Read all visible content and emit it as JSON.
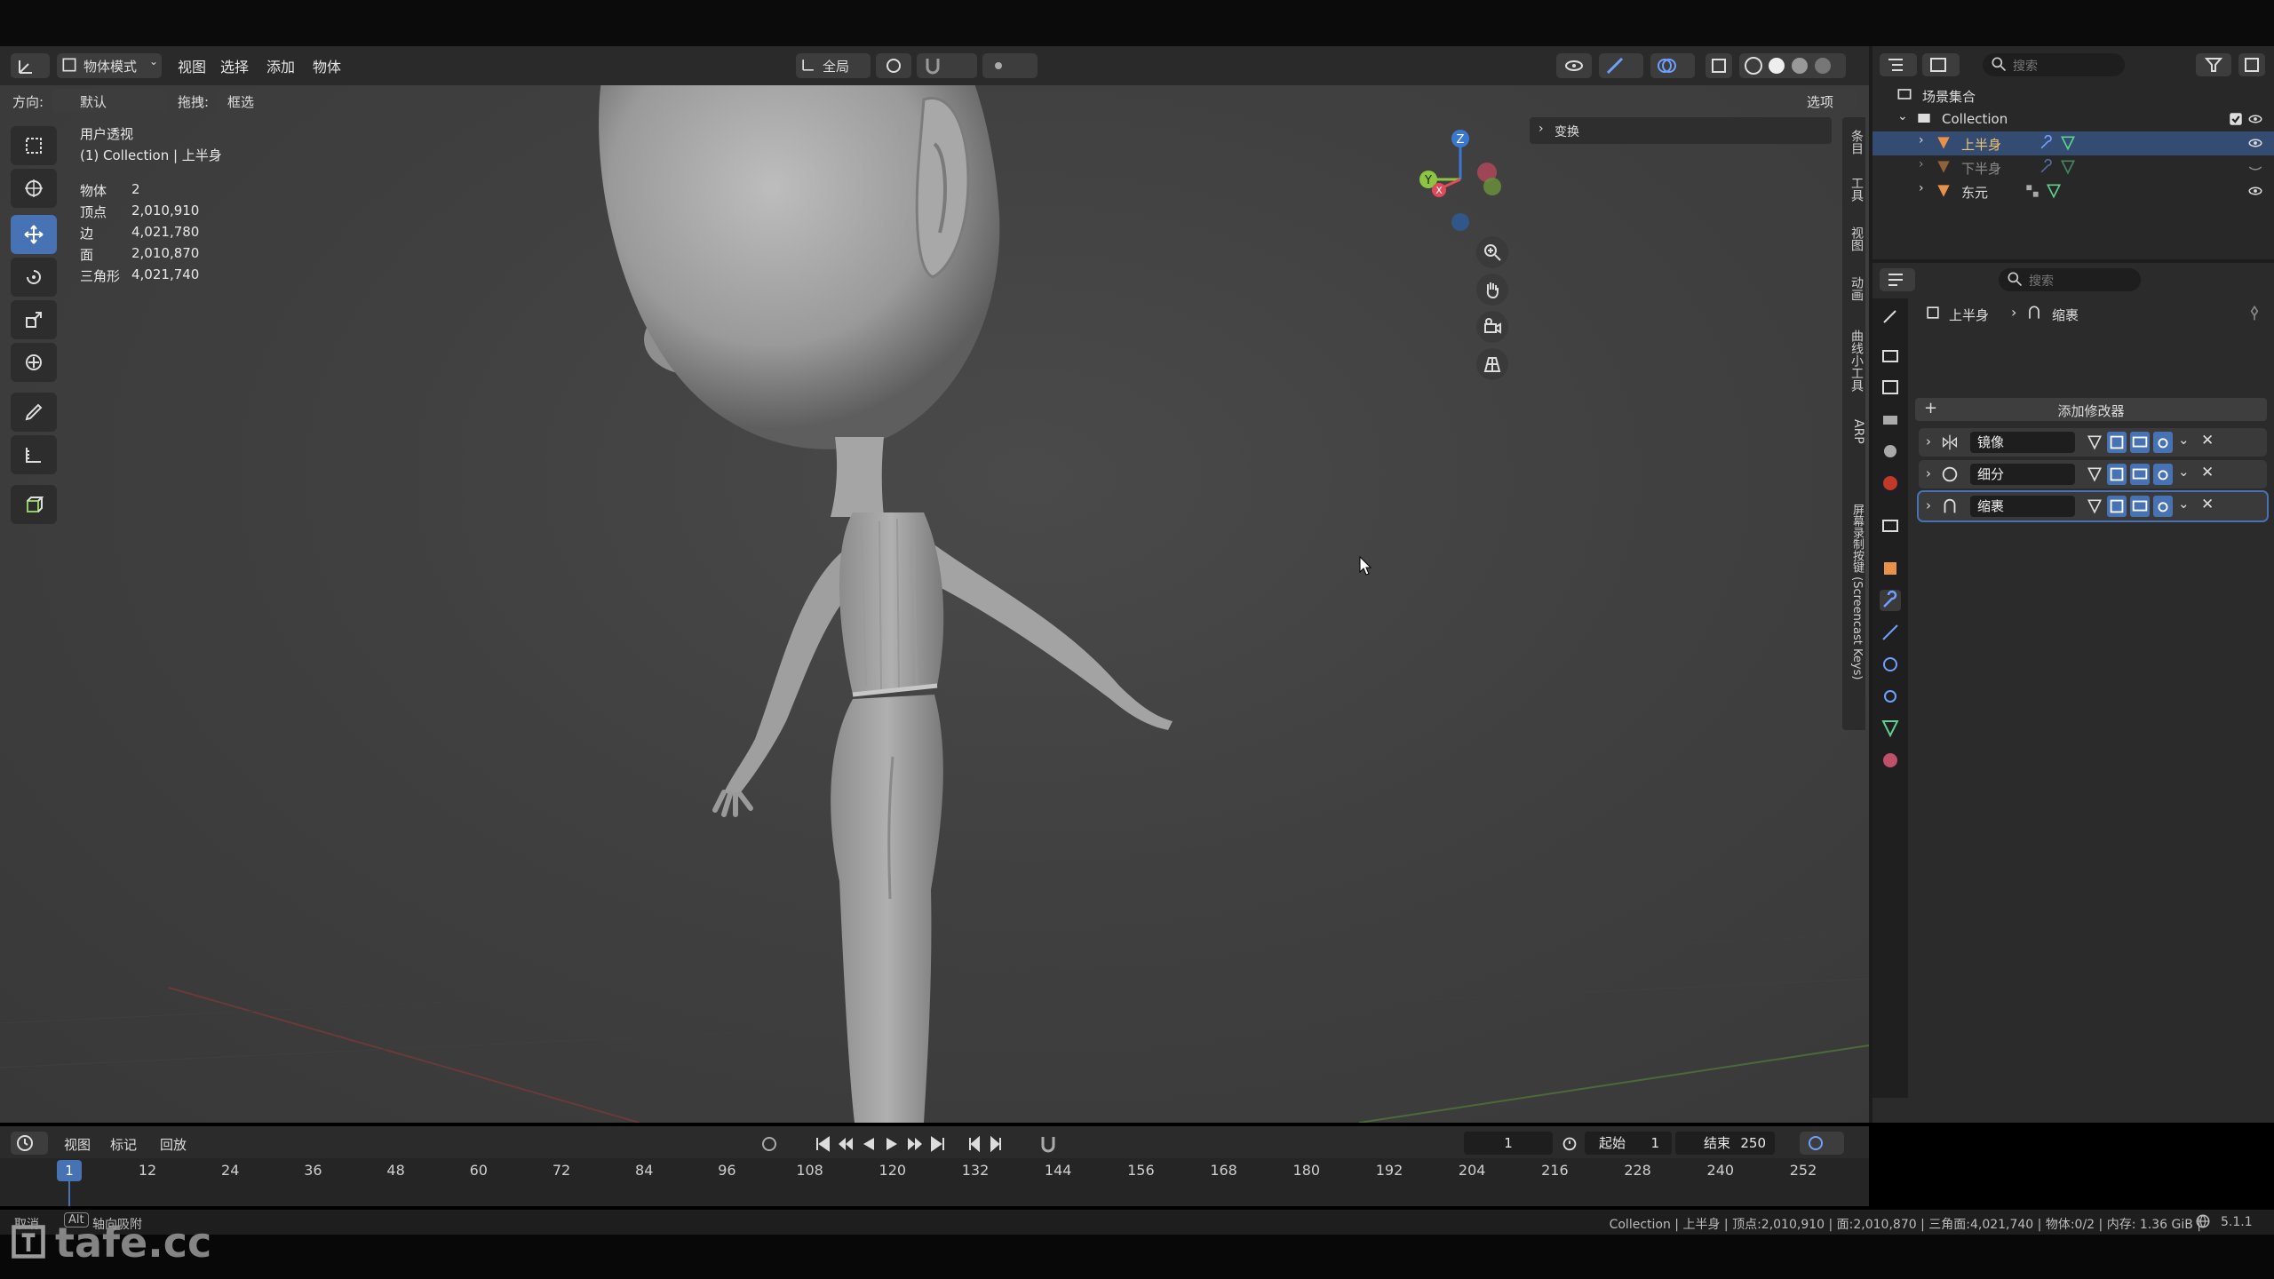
{
  "header": {
    "mode_label": "物体模式",
    "menu": [
      "视图",
      "选择",
      "添加",
      "物体"
    ],
    "transform_orientation": "全局"
  },
  "subheader": {
    "orientation_label": "方向:",
    "orientation_value": "默认",
    "drag_label": "拖拽:",
    "drag_value": "框选",
    "options_label": "选项"
  },
  "viewport": {
    "view_name": "用户透视",
    "collection_line": "(1) Collection | 上半身",
    "stats": [
      {
        "label": "物体",
        "value": "2"
      },
      {
        "label": "顶点",
        "value": "2,010,910"
      },
      {
        "label": "边",
        "value": "4,021,780"
      },
      {
        "label": "面",
        "value": "2,010,870"
      },
      {
        "label": "三角形",
        "value": "4,021,740"
      }
    ],
    "transform_panel_label": "变换",
    "gizmo_axes": {
      "x": "X",
      "y": "Y",
      "z": "Z"
    },
    "side_tabs": [
      "条目",
      "工具",
      "视图",
      "动画",
      "曲线小工具",
      "ARP",
      "屏幕录制按键 (Screencast Keys)"
    ]
  },
  "outliner": {
    "search_placeholder": "搜索",
    "scene_collection": "场景集合",
    "collection": "Collection",
    "objects": [
      {
        "name": "上半身",
        "selected": true
      },
      {
        "name": "下半身",
        "selected": false
      },
      {
        "name": "东元",
        "selected": false
      }
    ]
  },
  "properties": {
    "search_placeholder": "搜索",
    "breadcrumb_object": "上半身",
    "breadcrumb_modifier": "缩裹",
    "add_modifier_label": "添加修改器",
    "modifiers": [
      "镜像",
      "细分",
      "缩裹"
    ]
  },
  "timeline": {
    "menu": [
      "视图",
      "标记",
      "回放"
    ],
    "current_frame": "1",
    "start_label": "起始",
    "start_value": "1",
    "end_label": "结束",
    "end_value": "250",
    "ticks": [
      "1",
      "12",
      "24",
      "36",
      "48",
      "60",
      "72",
      "84",
      "96",
      "108",
      "120",
      "132",
      "144",
      "156",
      "168",
      "180",
      "192",
      "204",
      "216",
      "228",
      "240",
      "252"
    ]
  },
  "statusbar": {
    "left_hint_1": "取消",
    "left_hint_key": "Alt",
    "left_hint_2": "轴向吸附",
    "right_text": "Collection | 上半身 | 顶点:2,010,910 | 面:2,010,870 | 三角面:4,021,740 | 物体:0/2 | 内存: 1.36 GiB |",
    "version": "5.1.1"
  },
  "watermark": "tafe.cc",
  "colors": {
    "accent": "#4772b3",
    "selection": "#344b72",
    "axis_x": "#e04a5a",
    "axis_y": "#8cc640",
    "axis_z": "#3a78d0"
  }
}
